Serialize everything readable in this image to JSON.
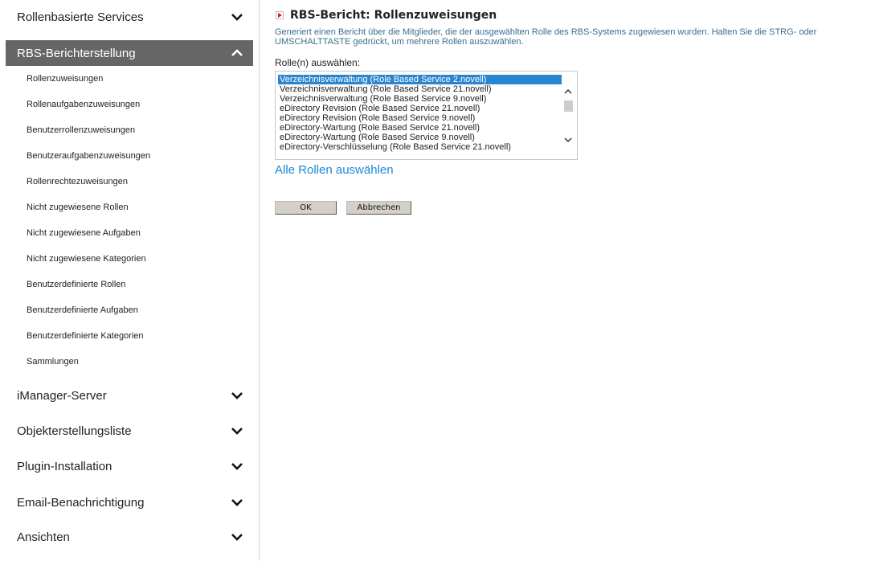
{
  "sidebar": {
    "sections_top": [
      {
        "label": "Rollenbasierte Services",
        "expanded": false
      },
      {
        "label": "RBS-Berichterstellung",
        "expanded": true
      }
    ],
    "items": [
      "Rollenzuweisungen",
      "Rollenaufgabenzuweisungen",
      "Benutzerrollenzuweisungen",
      "Benutzeraufgabenzuweisungen",
      "Rollenrechtezuweisungen",
      "Nicht zugewiesene Rollen",
      "Nicht zugewiesene Aufgaben",
      "Nicht zugewiesene Kategorien",
      "Benutzerdefinierte Rollen",
      "Benutzerdefinierte Aufgaben",
      "Benutzerdefinierte Kategorien",
      "Sammlungen"
    ],
    "sections_bottom": [
      "iManager-Server",
      "Objekterstellungsliste",
      "Plugin-Installation",
      "Email-Benachrichtigung",
      "Ansichten"
    ]
  },
  "main": {
    "title": "RBS-Bericht: Rollenzuweisungen",
    "description": "Generiert einen Bericht über die Mitglieder, die der ausgewählten Rolle des RBS-Systems zugewiesen wurden. Halten Sie die STRG- oder UMSCHALTTASTE gedrückt, um mehrere Rollen auszuwählen.",
    "select_label": "Rolle(n) auswählen:",
    "roles": [
      "Verzeichnisverwaltung (Role Based Service 2.novell)",
      "Verzeichnisverwaltung (Role Based Service 21.novell)",
      "Verzeichnisverwaltung (Role Based Service 9.novell)",
      "eDirectory Revision (Role Based Service 21.novell)",
      "eDirectory Revision (Role Based Service 9.novell)",
      "eDirectory-Wartung (Role Based Service 21.novell)",
      "eDirectory-Wartung (Role Based Service 9.novell)",
      "eDirectory-Verschlüsselung (Role Based Service 21.novell)"
    ],
    "selected_role": "Verzeichnisverwaltung (Role Based Service 2.novell)",
    "select_all_link": "Alle Rollen auswählen",
    "ok_label": "OK",
    "cancel_label": "Abbrechen"
  },
  "colors": {
    "active_section_bg": "#666666",
    "description_text": "#3a6e8f",
    "link": "#1a8ad4",
    "selection": "#2a85d0"
  }
}
